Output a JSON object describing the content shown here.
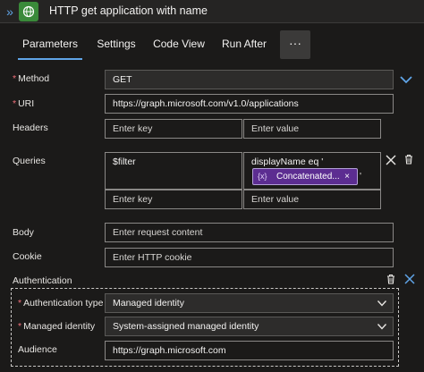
{
  "header": {
    "title": "HTTP get application with name"
  },
  "tabs": [
    {
      "label": "Parameters",
      "active": true
    },
    {
      "label": "Settings",
      "active": false
    },
    {
      "label": "Code View",
      "active": false
    },
    {
      "label": "Run After",
      "active": false
    }
  ],
  "tabs_more_label": "···",
  "method": {
    "label": "Method",
    "required": true,
    "value": "GET"
  },
  "uri": {
    "label": "URI",
    "required": true,
    "value": "https://graph.microsoft.com/v1.0/applications"
  },
  "headers": {
    "label": "Headers",
    "key_placeholder": "Enter key",
    "value_placeholder": "Enter value"
  },
  "queries": {
    "label": "Queries",
    "row1_key": "$filter",
    "row1_value_text": "displayName eq '",
    "row1_value_suffix": "'",
    "token": {
      "icon": "{x}",
      "label": "Concatenated...",
      "close": "×"
    },
    "row2_key_placeholder": "Enter key",
    "row2_value_placeholder": "Enter value"
  },
  "body_field": {
    "label": "Body",
    "placeholder": "Enter request content"
  },
  "cookie": {
    "label": "Cookie",
    "placeholder": "Enter HTTP cookie"
  },
  "authentication": {
    "label": "Authentication",
    "type_label": "Authentication type",
    "type_value": "Managed identity",
    "identity_label": "Managed identity",
    "identity_value": "System-assigned managed identity",
    "audience_label": "Audience",
    "audience_value": "https://graph.microsoft.com"
  },
  "colors": {
    "accent": "#60a5e8",
    "token": "#5c2d91",
    "required": "#f1707b",
    "app_icon": "#3a8a3a"
  },
  "icons": [
    "collapse-icon",
    "globe-icon",
    "chevron-down-icon",
    "close-icon",
    "delete-icon"
  ]
}
